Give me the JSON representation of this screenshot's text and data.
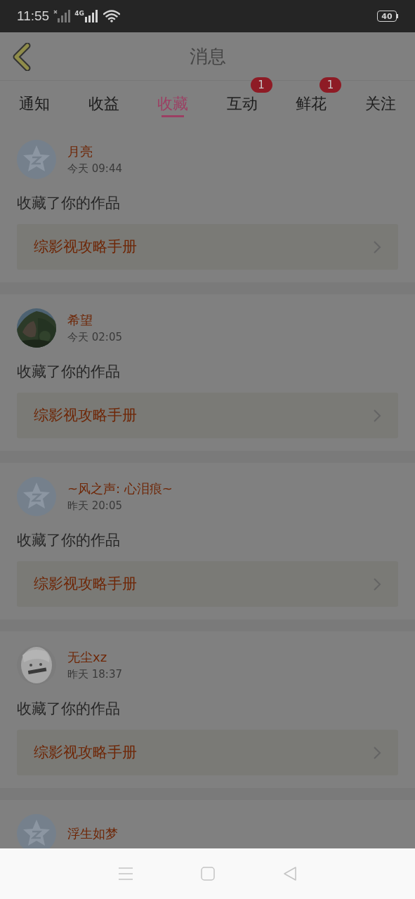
{
  "status_bar": {
    "time": "11:55",
    "network": "4G",
    "battery": "40"
  },
  "header": {
    "title": "消息"
  },
  "tabs": [
    {
      "label": "通知",
      "selected": false
    },
    {
      "label": "收益",
      "selected": false
    },
    {
      "label": "收藏",
      "selected": true
    },
    {
      "label": "互动",
      "selected": false,
      "badge": "1"
    },
    {
      "label": "鲜花",
      "selected": false,
      "badge": "1"
    },
    {
      "label": "关注",
      "selected": false
    }
  ],
  "messages": [
    {
      "avatar": {
        "kind": "default"
      },
      "name": "月亮",
      "time": "今天 09:44",
      "action": "收藏了你的作品",
      "work": "综影视攻略手册"
    },
    {
      "name": "希望",
      "time": "今天 02:05",
      "action": "收藏了你的作品",
      "work": "综影视攻略手册"
    },
    {
      "avatar": {
        "kind": "default"
      },
      "name": "~风之声: 心泪痕~",
      "time": "昨天 20:05",
      "action": "收藏了你的作品",
      "work": "综影视攻略手册"
    },
    {
      "avatar": {
        "kind": "sketch"
      },
      "name": "无尘xz",
      "time": "昨天 18:37",
      "action": "收藏了你的作品",
      "work": "综影视攻略手册"
    },
    {
      "avatar": {
        "kind": "default"
      },
      "name": "浮生如梦"
    }
  ]
}
